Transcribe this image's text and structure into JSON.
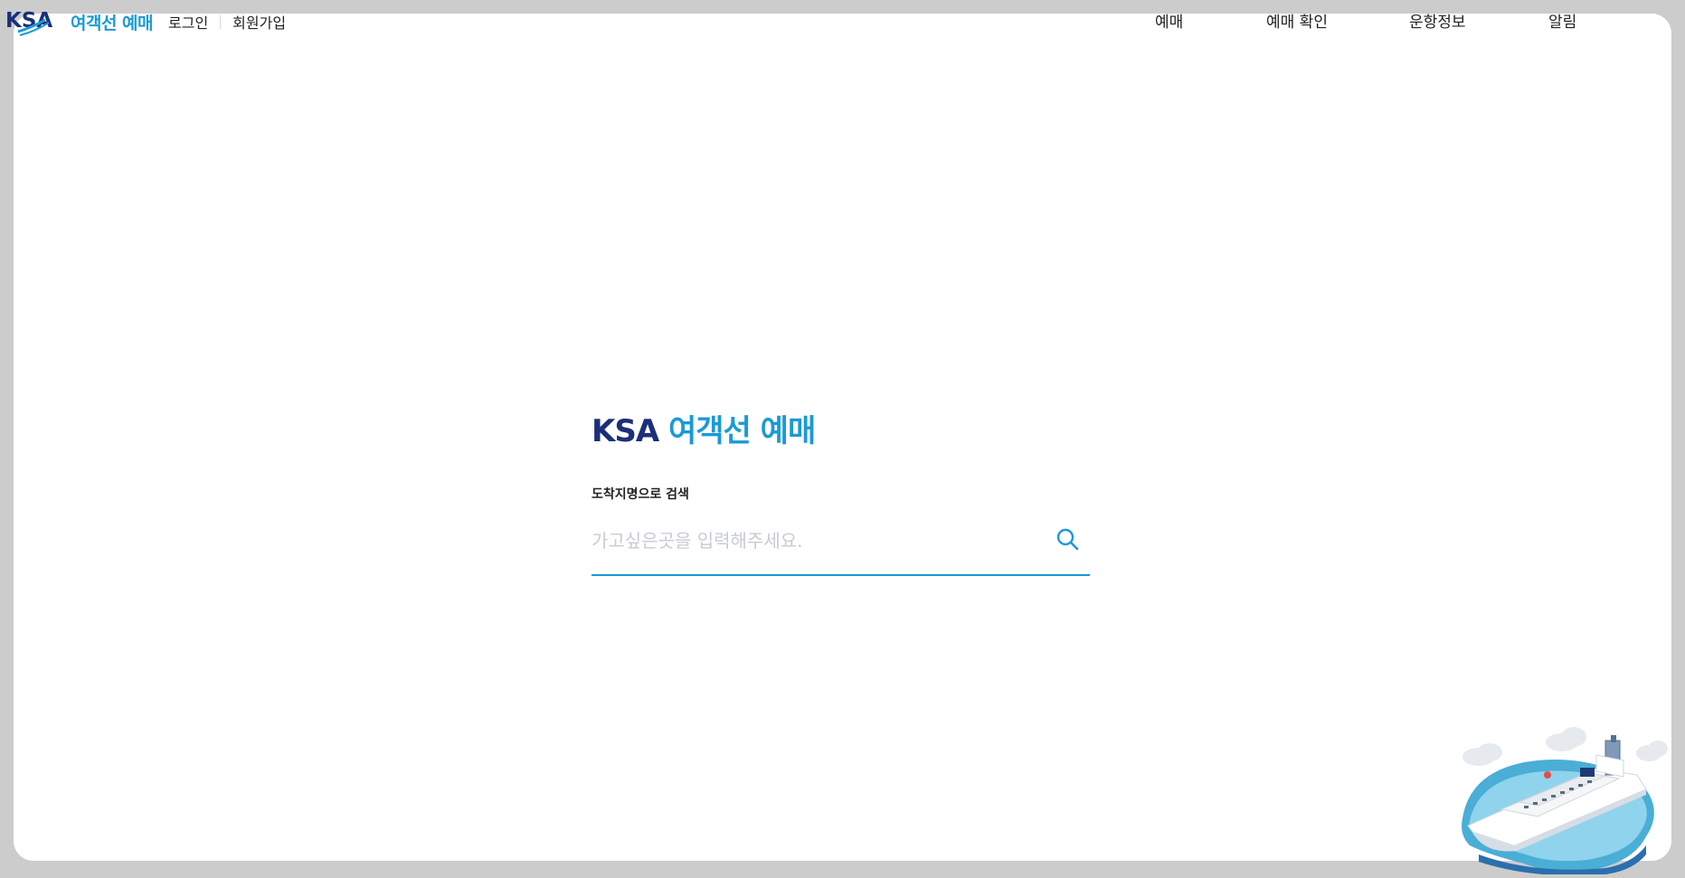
{
  "header": {
    "logo_mark": "KSA",
    "logo_text": "여객선 예매",
    "login": "로그인",
    "signup": "회원가입",
    "nav": [
      {
        "label": "예매"
      },
      {
        "label": "예매 확인"
      },
      {
        "label": "운항정보"
      },
      {
        "label": "알림"
      }
    ]
  },
  "main": {
    "brand_ksa": "KSA",
    "brand_title": "여객선 예매",
    "search_label": "도착지명으로 검색",
    "search_placeholder": "가고싶은곳을 입력해주세요.",
    "search_value": ""
  },
  "icons": {
    "search": "search-icon",
    "ship": "ship-illustration"
  },
  "colors": {
    "accent": "#1a9ad6",
    "navy": "#1b2f7a",
    "frame_bg": "#cccccc"
  }
}
